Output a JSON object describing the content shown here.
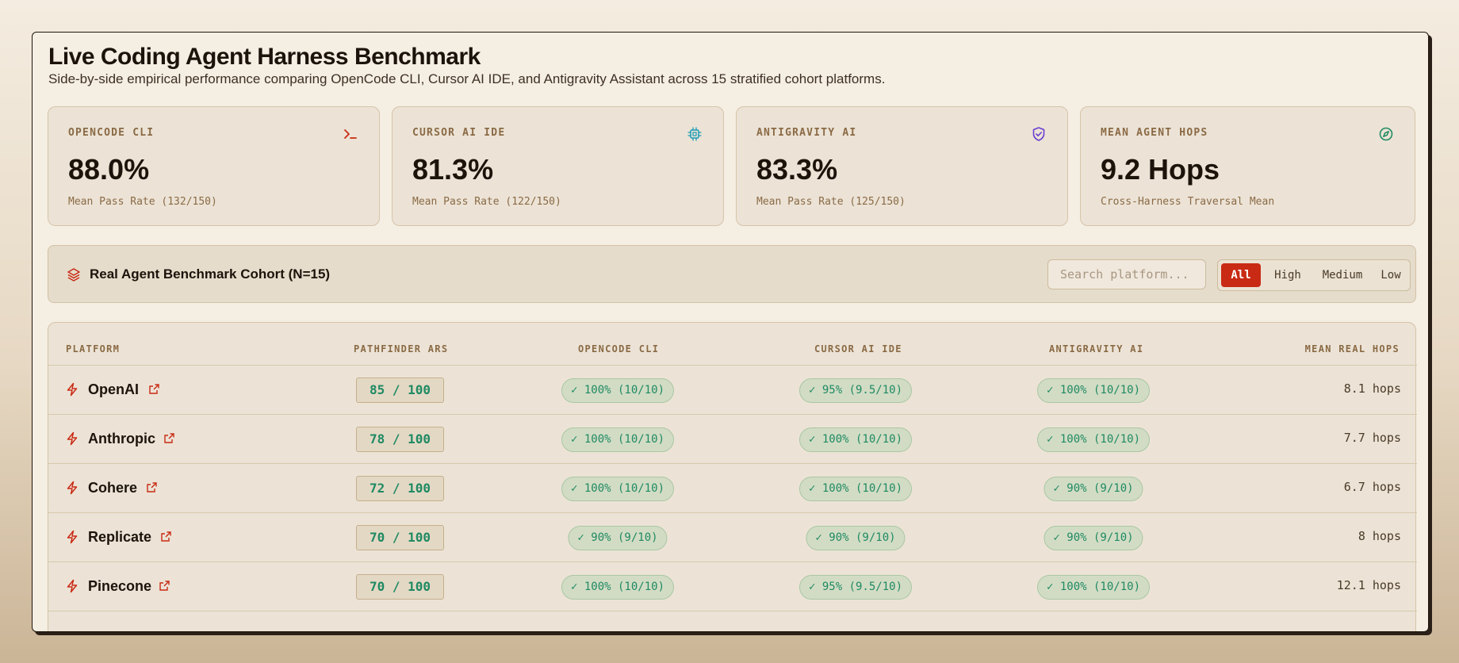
{
  "header": {
    "title": "Live Coding Agent Harness Benchmark",
    "subtitle": "Side-by-side empirical performance comparing OpenCode CLI, Cursor AI IDE, and Antigravity Assistant across 15 stratified cohort platforms."
  },
  "cards": [
    {
      "label": "OPENCODE CLI",
      "value": "88.0%",
      "sub": "Mean Pass Rate (132/150)",
      "icon": "terminal-icon",
      "icon_color": "#c92a14"
    },
    {
      "label": "CURSOR AI IDE",
      "value": "81.3%",
      "sub": "Mean Pass Rate (122/150)",
      "icon": "chip-icon",
      "icon_color": "#1c9bb5"
    },
    {
      "label": "ANTIGRAVITY AI",
      "value": "83.3%",
      "sub": "Mean Pass Rate (125/150)",
      "icon": "shield-check-icon",
      "icon_color": "#6a3fd1"
    },
    {
      "label": "MEAN AGENT HOPS",
      "value": "9.2 Hops",
      "sub": "Cross-Harness Traversal Mean",
      "icon": "compass-icon",
      "icon_color": "#1f8a63"
    }
  ],
  "cohort": {
    "title": "Real Agent Benchmark Cohort (N=15)",
    "icon": "layers-icon",
    "search_placeholder": "Search platform...",
    "filters": [
      "All",
      "High",
      "Medium",
      "Low"
    ],
    "active_filter": "All"
  },
  "table": {
    "columns": [
      "PLATFORM",
      "PATHFINDER ARS",
      "OPENCODE CLI",
      "CURSOR AI IDE",
      "ANTIGRAVITY AI",
      "MEAN REAL HOPS"
    ],
    "rows": [
      {
        "platform": "OpenAI",
        "ars": "85 / 100",
        "opencode": "✓ 100% (10/10)",
        "cursor": "✓ 95% (9.5/10)",
        "antigravity": "✓ 100% (10/10)",
        "hops": "8.1 hops"
      },
      {
        "platform": "Anthropic",
        "ars": "78 / 100",
        "opencode": "✓ 100% (10/10)",
        "cursor": "✓ 100% (10/10)",
        "antigravity": "✓ 100% (10/10)",
        "hops": "7.7 hops"
      },
      {
        "platform": "Cohere",
        "ars": "72 / 100",
        "opencode": "✓ 100% (10/10)",
        "cursor": "✓ 100% (10/10)",
        "antigravity": "✓ 90% (9/10)",
        "hops": "6.7 hops"
      },
      {
        "platform": "Replicate",
        "ars": "70 / 100",
        "opencode": "✓ 90% (9/10)",
        "cursor": "✓ 90% (9/10)",
        "antigravity": "✓ 90% (9/10)",
        "hops": "8 hops"
      },
      {
        "platform": "Pinecone",
        "ars": "70 / 100",
        "opencode": "✓ 100% (10/10)",
        "cursor": "✓ 95% (9.5/10)",
        "antigravity": "✓ 100% (10/10)",
        "hops": "12.1 hops"
      }
    ]
  },
  "colors": {
    "accent": "#c92a14",
    "pass_green": "#1f8a63",
    "muted_label": "#8a6a45"
  }
}
